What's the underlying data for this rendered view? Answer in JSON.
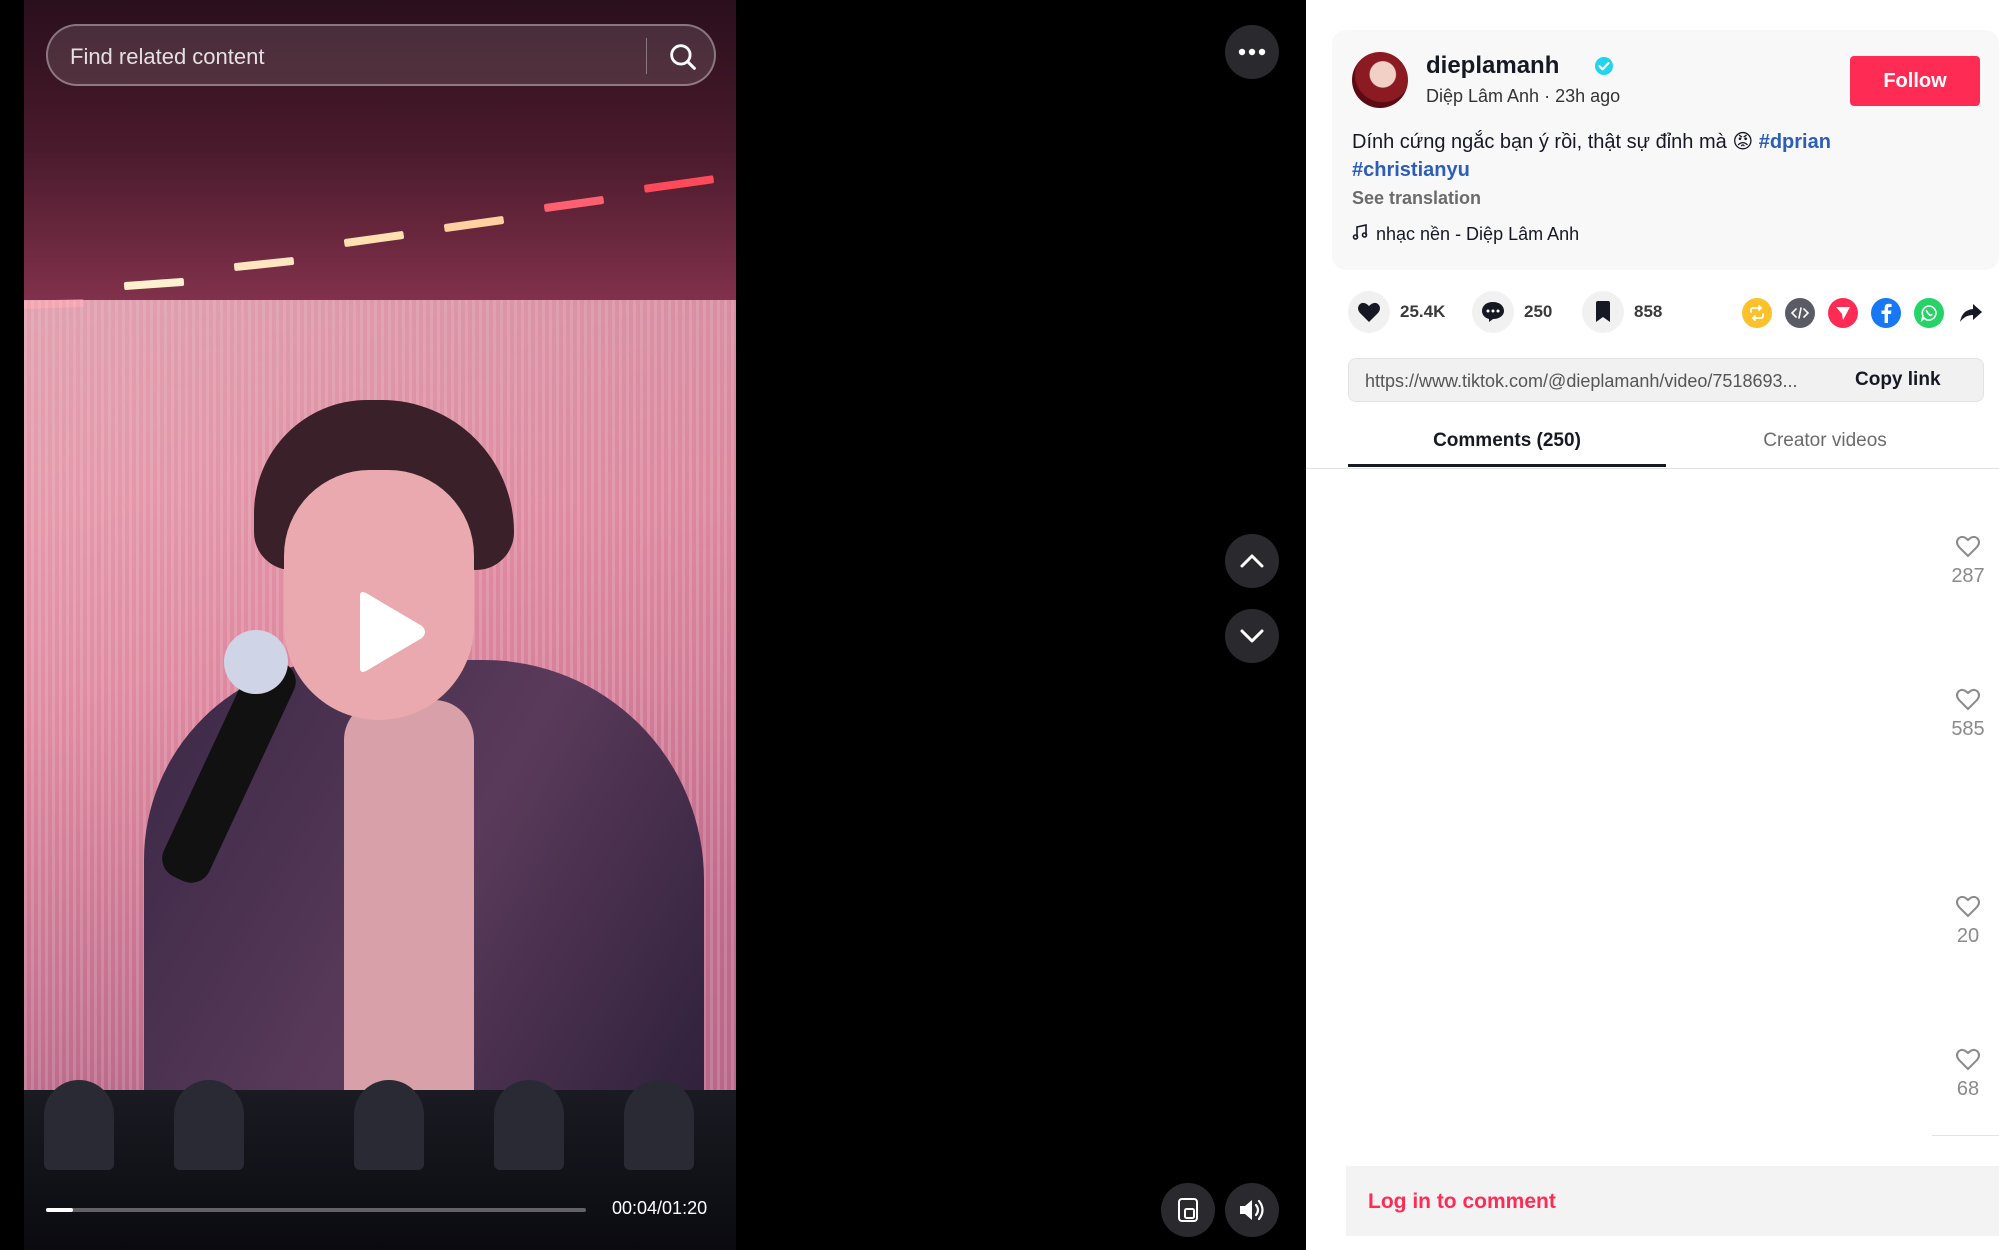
{
  "search": {
    "placeholder": "Find related content"
  },
  "player": {
    "time": "00:04/01:20",
    "progress": 0.05
  },
  "author": {
    "username": "dieplamanh",
    "display_name_time": "Diệp Lâm Anh · 23h ago",
    "follow_label": "Follow"
  },
  "caption": {
    "text": "Dính cứng ngắc bạn ý rồi, thật sự đỉnh mà 😡 ",
    "tag1": "#dprian",
    "tag2": "#christianyu",
    "see_translation": "See translation"
  },
  "music": {
    "label": "nhạc nền - Diệp Lâm Anh"
  },
  "stats": {
    "likes": "25.4K",
    "comments": "250",
    "saves": "858"
  },
  "share": {
    "icons": [
      "repost-icon",
      "embed-icon",
      "send-icon",
      "facebook-icon",
      "whatsapp-icon",
      "share-arrow-icon"
    ],
    "colors": {
      "repost": "#fcc12b",
      "embed": "#5b5b66",
      "send": "#fe2c55",
      "facebook": "#1877f2",
      "whatsapp": "#25d366"
    }
  },
  "link": {
    "url": "https://www.tiktok.com/@dieplamanh/video/7518693...",
    "copy_label": "Copy link"
  },
  "tabs": {
    "comments": "Comments (250)",
    "creator": "Creator videos"
  },
  "comment_likes": [
    "287",
    "585",
    "20",
    "68"
  ],
  "login": {
    "label": "Log in to comment"
  },
  "colors": {
    "accent": "#fe2c55",
    "hashtag": "#2b5db9",
    "verified": "#20d5ec"
  }
}
